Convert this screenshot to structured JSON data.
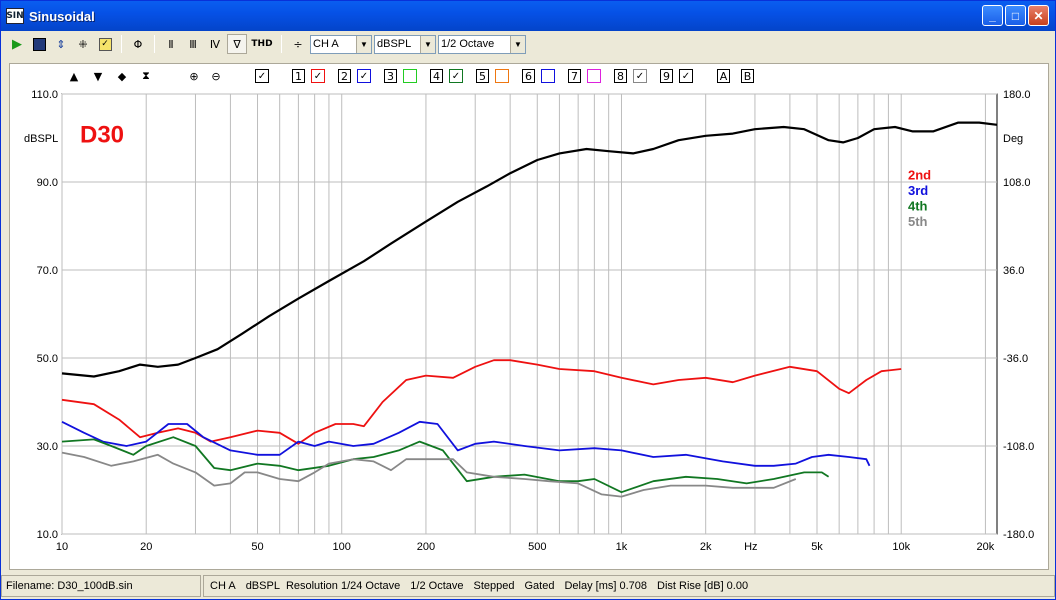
{
  "window": {
    "title": "Sinusoidal",
    "app_icon_text": "SIN"
  },
  "toolbar": {
    "thd_label": "THD",
    "channel": "CH A",
    "unit": "dBSPL",
    "smoothing": "1/2 Octave"
  },
  "plot_controls": {
    "checks": [
      "1",
      "2",
      "3",
      "4",
      "5",
      "6",
      "7",
      "8",
      "9"
    ],
    "a": "A",
    "b": "B"
  },
  "colors": {
    "response": "#000000",
    "h2": "#ee1111",
    "h3": "#1111dd",
    "h4": "#117722",
    "h5": "#888888",
    "label": "#ee1111"
  },
  "chart_data": {
    "type": "line",
    "title": "D30",
    "left_axis_unit": "dBSPL",
    "right_axis_unit": "Deg",
    "x_unit": "Hz",
    "xscale": "log",
    "xlim": [
      10,
      22000
    ],
    "ylim": [
      10,
      110
    ],
    "y2lim": [
      -180,
      180
    ],
    "yticks": [
      "10.0",
      "30.0",
      "50.0",
      "70.0",
      "90.0",
      "110.0"
    ],
    "y2ticks": [
      "-180.0",
      "-108.0",
      "-36.0",
      "36.0",
      "108.0",
      "180.0"
    ],
    "xticks": [
      {
        "v": 10,
        "t": "10"
      },
      {
        "v": 20,
        "t": "20"
      },
      {
        "v": 50,
        "t": "50"
      },
      {
        "v": 100,
        "t": "100"
      },
      {
        "v": 200,
        "t": "200"
      },
      {
        "v": 500,
        "t": "500"
      },
      {
        "v": 1000,
        "t": "1k"
      },
      {
        "v": 2000,
        "t": "2k"
      },
      {
        "v": 5000,
        "t": "5k"
      },
      {
        "v": 10000,
        "t": "10k"
      },
      {
        "v": 20000,
        "t": "20k"
      }
    ],
    "legend": [
      "2nd",
      "3rd",
      "4th",
      "5th"
    ],
    "series": [
      {
        "key": "response",
        "color": "#000000",
        "points": [
          [
            10,
            46.5
          ],
          [
            13,
            45.8
          ],
          [
            16,
            47
          ],
          [
            19,
            48.5
          ],
          [
            22,
            48
          ],
          [
            26,
            48.5
          ],
          [
            30,
            50
          ],
          [
            36,
            52
          ],
          [
            44,
            55.5
          ],
          [
            55,
            59.5
          ],
          [
            70,
            63.5
          ],
          [
            90,
            67.5
          ],
          [
            120,
            72
          ],
          [
            150,
            76
          ],
          [
            200,
            81
          ],
          [
            260,
            85.5
          ],
          [
            330,
            89
          ],
          [
            400,
            92
          ],
          [
            500,
            95
          ],
          [
            600,
            96.5
          ],
          [
            750,
            97.5
          ],
          [
            900,
            97
          ],
          [
            1100,
            96.5
          ],
          [
            1300,
            97.5
          ],
          [
            1600,
            99.5
          ],
          [
            2000,
            100.5
          ],
          [
            2500,
            101
          ],
          [
            3000,
            102
          ],
          [
            3800,
            102.5
          ],
          [
            4500,
            102
          ],
          [
            5500,
            99.5
          ],
          [
            6200,
            99
          ],
          [
            7000,
            100
          ],
          [
            8000,
            102
          ],
          [
            9500,
            102.5
          ],
          [
            11000,
            101.5
          ],
          [
            13000,
            101.5
          ],
          [
            16000,
            103.5
          ],
          [
            19000,
            103.5
          ],
          [
            22000,
            103
          ]
        ]
      },
      {
        "key": "h2",
        "color": "#ee1111",
        "points": [
          [
            10,
            40.5
          ],
          [
            13,
            39.5
          ],
          [
            16,
            36
          ],
          [
            19,
            32
          ],
          [
            22,
            33
          ],
          [
            26,
            34
          ],
          [
            30,
            33
          ],
          [
            34,
            31
          ],
          [
            40,
            32
          ],
          [
            50,
            33.5
          ],
          [
            60,
            33
          ],
          [
            70,
            30.5
          ],
          [
            80,
            33
          ],
          [
            95,
            35
          ],
          [
            110,
            35
          ],
          [
            120,
            34.5
          ],
          [
            140,
            40
          ],
          [
            170,
            45
          ],
          [
            200,
            46
          ],
          [
            250,
            45.5
          ],
          [
            300,
            48
          ],
          [
            350,
            49.5
          ],
          [
            400,
            49.5
          ],
          [
            500,
            48.5
          ],
          [
            600,
            47.5
          ],
          [
            800,
            47
          ],
          [
            1000,
            45.5
          ],
          [
            1300,
            44
          ],
          [
            1600,
            45
          ],
          [
            2000,
            45.5
          ],
          [
            2500,
            44.5
          ],
          [
            3000,
            46
          ],
          [
            4000,
            48
          ],
          [
            5000,
            47
          ],
          [
            6000,
            43
          ],
          [
            6500,
            42
          ],
          [
            7500,
            45
          ],
          [
            8500,
            47
          ],
          [
            10000,
            47.5
          ]
        ]
      },
      {
        "key": "h3",
        "color": "#1111dd",
        "points": [
          [
            10,
            35.5
          ],
          [
            12,
            33
          ],
          [
            14,
            31
          ],
          [
            17,
            30
          ],
          [
            20,
            31
          ],
          [
            24,
            35
          ],
          [
            28,
            35
          ],
          [
            32,
            32
          ],
          [
            40,
            29
          ],
          [
            50,
            28
          ],
          [
            60,
            28
          ],
          [
            70,
            31
          ],
          [
            80,
            30
          ],
          [
            90,
            31
          ],
          [
            110,
            30
          ],
          [
            130,
            30.5
          ],
          [
            160,
            33
          ],
          [
            190,
            35.5
          ],
          [
            220,
            35
          ],
          [
            260,
            29
          ],
          [
            300,
            30.5
          ],
          [
            350,
            31
          ],
          [
            450,
            30
          ],
          [
            600,
            29
          ],
          [
            800,
            29.5
          ],
          [
            1000,
            29
          ],
          [
            1300,
            27.5
          ],
          [
            1700,
            28
          ],
          [
            2300,
            26.5
          ],
          [
            3000,
            25.5
          ],
          [
            3500,
            25.5
          ],
          [
            4200,
            26
          ],
          [
            4800,
            27.5
          ],
          [
            5500,
            28
          ],
          [
            6500,
            27.5
          ],
          [
            7500,
            27
          ],
          [
            7700,
            25.5
          ]
        ]
      },
      {
        "key": "h4",
        "color": "#117722",
        "points": [
          [
            10,
            31
          ],
          [
            13,
            31.5
          ],
          [
            15,
            30
          ],
          [
            18,
            28
          ],
          [
            20,
            30
          ],
          [
            25,
            32
          ],
          [
            30,
            30
          ],
          [
            35,
            25
          ],
          [
            40,
            24.5
          ],
          [
            50,
            26
          ],
          [
            60,
            25.5
          ],
          [
            70,
            24.5
          ],
          [
            90,
            25.5
          ],
          [
            110,
            27
          ],
          [
            130,
            27.5
          ],
          [
            160,
            29
          ],
          [
            190,
            31
          ],
          [
            230,
            29
          ],
          [
            280,
            22
          ],
          [
            350,
            23
          ],
          [
            450,
            23.5
          ],
          [
            600,
            22
          ],
          [
            700,
            22
          ],
          [
            800,
            22.5
          ],
          [
            1000,
            19.5
          ],
          [
            1300,
            22
          ],
          [
            1700,
            23
          ],
          [
            2200,
            22.5
          ],
          [
            2800,
            21.5
          ],
          [
            3500,
            22.5
          ],
          [
            4500,
            24
          ],
          [
            5200,
            24
          ],
          [
            5500,
            23
          ]
        ]
      },
      {
        "key": "h5",
        "color": "#888888",
        "points": [
          [
            10,
            28.5
          ],
          [
            12,
            27.5
          ],
          [
            15,
            25.5
          ],
          [
            18,
            26.5
          ],
          [
            22,
            28
          ],
          [
            25,
            26
          ],
          [
            30,
            24
          ],
          [
            35,
            21
          ],
          [
            40,
            21.5
          ],
          [
            45,
            24
          ],
          [
            50,
            24
          ],
          [
            60,
            22.5
          ],
          [
            70,
            22
          ],
          [
            80,
            24
          ],
          [
            90,
            26
          ],
          [
            110,
            27
          ],
          [
            130,
            26.5
          ],
          [
            150,
            24.5
          ],
          [
            170,
            27
          ],
          [
            210,
            27
          ],
          [
            250,
            27
          ],
          [
            280,
            24
          ],
          [
            350,
            23
          ],
          [
            450,
            22.5
          ],
          [
            550,
            22
          ],
          [
            700,
            21.5
          ],
          [
            850,
            19
          ],
          [
            1000,
            18.5
          ],
          [
            1200,
            20
          ],
          [
            1500,
            21
          ],
          [
            2000,
            21
          ],
          [
            2500,
            20.5
          ],
          [
            3000,
            20.5
          ],
          [
            3500,
            20.5
          ],
          [
            4200,
            22.5
          ]
        ]
      }
    ]
  },
  "status": {
    "filename": "Filename: D30_100dB.sin",
    "channel": "CH A",
    "unit": "dBSPL",
    "resolution": "Resolution 1/24 Octave",
    "smoothing": "1/2 Octave",
    "mode": "Stepped",
    "gated": "Gated",
    "delay": "Delay [ms] 0.708",
    "rise": "Dist Rise [dB] 0.00"
  }
}
